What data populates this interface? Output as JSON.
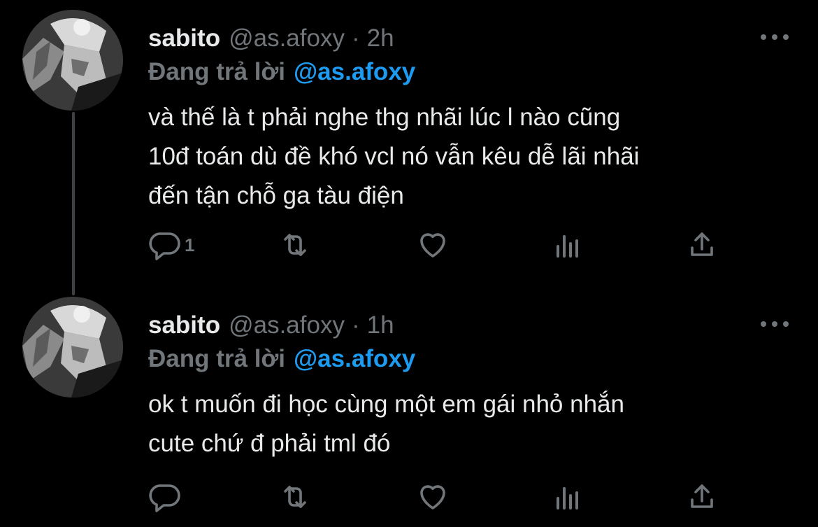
{
  "colors": {
    "background": "#000000",
    "primary_text": "#e7e9ea",
    "secondary_text": "#71767b",
    "accent": "#1d9bf0",
    "thread_line": "#3e4144"
  },
  "tweets": [
    {
      "display_name": "sabito",
      "handle": "@as.afoxy",
      "separator": "·",
      "time": "2h",
      "reply_label": "Đang trả lời",
      "reply_handle": "@as.afoxy",
      "text_lines": [
        "và thế là t phải nghe thg nhãi lúc l nào cũng",
        "10đ toán dù đề khó vcl nó vẫn kêu dễ lãi nhãi",
        "đến tận chỗ ga tàu điện"
      ],
      "reply_count": "1",
      "icons": [
        "reply-icon",
        "retweet-icon",
        "like-icon",
        "views-icon",
        "share-icon",
        "more-icon"
      ]
    },
    {
      "display_name": "sabito",
      "handle": "@as.afoxy",
      "separator": "·",
      "time": "1h",
      "reply_label": "Đang trả lời",
      "reply_handle": "@as.afoxy",
      "text_lines": [
        "ok t muốn đi học cùng một em gái nhỏ nhắn",
        "cute chứ đ phải tml đó"
      ],
      "reply_count": "",
      "icons": [
        "reply-icon",
        "retweet-icon",
        "like-icon",
        "views-icon",
        "share-icon",
        "more-icon"
      ]
    }
  ]
}
